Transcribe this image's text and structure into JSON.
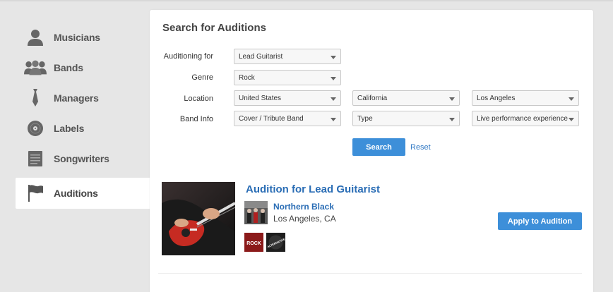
{
  "sidebar": {
    "items": [
      {
        "label": "Musicians",
        "icon": "person-icon"
      },
      {
        "label": "Bands",
        "icon": "group-icon"
      },
      {
        "label": "Managers",
        "icon": "tie-icon"
      },
      {
        "label": "Labels",
        "icon": "vinyl-record-icon"
      },
      {
        "label": "Songwriters",
        "icon": "notepad-icon"
      },
      {
        "label": "Auditions",
        "icon": "flag-icon",
        "active": true
      }
    ]
  },
  "search": {
    "title": "Search for Auditions",
    "auditioning_for": {
      "label": "Auditioning for",
      "value": "Lead Guitarist"
    },
    "genre": {
      "label": "Genre",
      "value": "Rock"
    },
    "location": {
      "label": "Location",
      "country": "United States",
      "state": "California",
      "city": "Los Angeles"
    },
    "band_info": {
      "label": "Band Info",
      "band_type": "Cover / Tribute Band",
      "type": "Type",
      "experience": "Live performance experience"
    },
    "search_button": "Search",
    "reset_link": "Reset"
  },
  "result": {
    "title": "Audition for Lead Guitarist",
    "band_name": "Northern Black",
    "band_location": "Los Angeles, CA",
    "tags": [
      "ROCK",
      "ALTERNATIVE"
    ],
    "apply_button": "Apply to Audition"
  },
  "colors": {
    "accent": "#3d8fd9",
    "link": "#2a6db5",
    "background": "#e6e6e6"
  }
}
